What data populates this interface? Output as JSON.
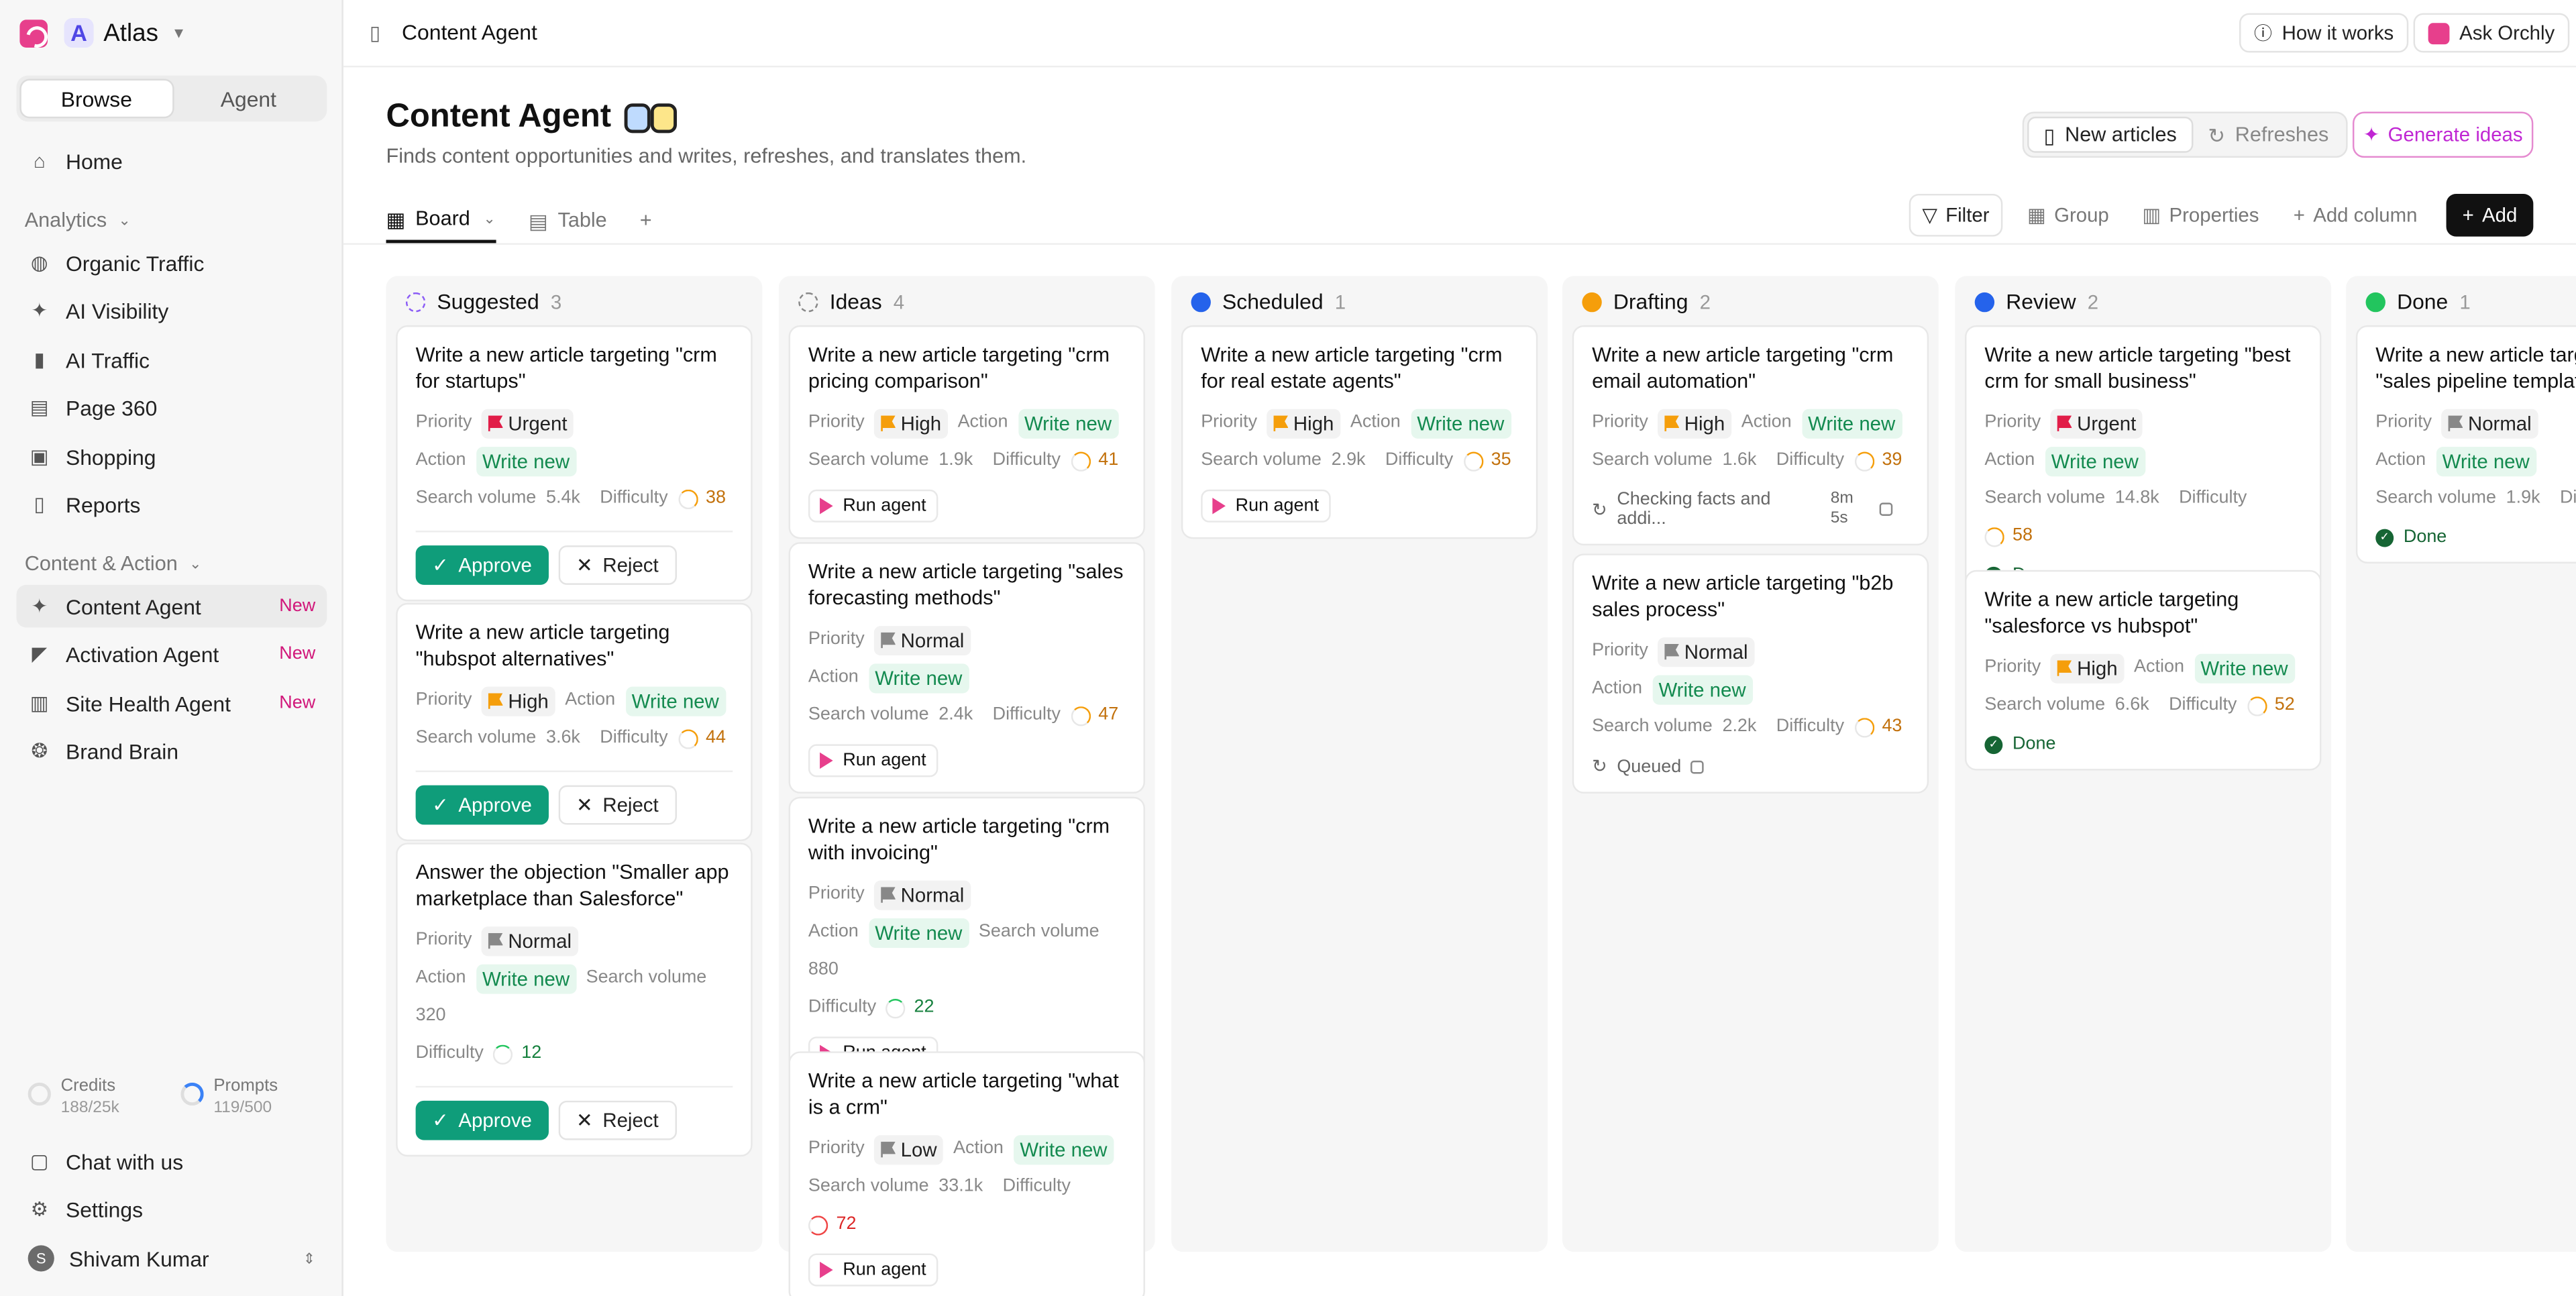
{
  "sidebar": {
    "workspace": "Atlas",
    "workspace_initial": "A",
    "modes": [
      "Browse",
      "Agent"
    ],
    "nav_top": [
      {
        "label": "Home",
        "icon": "home-icon"
      }
    ],
    "analytics_label": "Analytics",
    "analytics": [
      {
        "label": "Organic Traffic",
        "icon": "globe-icon"
      },
      {
        "label": "AI Visibility",
        "icon": "sparkle-icon"
      },
      {
        "label": "AI Traffic",
        "icon": "bar-chart-icon"
      },
      {
        "label": "Page 360",
        "icon": "layers-icon"
      },
      {
        "label": "Shopping",
        "icon": "bag-icon"
      },
      {
        "label": "Reports",
        "icon": "document-icon"
      }
    ],
    "content_label": "Content & Action",
    "content": [
      {
        "label": "Content Agent",
        "badge": "New",
        "icon": "sparkle-icon"
      },
      {
        "label": "Activation Agent",
        "badge": "New",
        "icon": "megaphone-icon"
      },
      {
        "label": "Site Health Agent",
        "badge": "New",
        "icon": "clipboard-icon"
      },
      {
        "label": "Brand Brain",
        "badge": "",
        "icon": "brain-icon"
      }
    ],
    "credits": {
      "label": "Credits",
      "value": "188/25k"
    },
    "prompts": {
      "label": "Prompts",
      "value": "119/500"
    },
    "chat": "Chat with us",
    "settings": "Settings",
    "user": {
      "name": "Shivam Kumar",
      "initial": "S"
    }
  },
  "topbar": {
    "breadcrumb": "Content Agent",
    "how": "How it works",
    "ask": "Ask Orchly"
  },
  "header": {
    "title": "Content Agent",
    "subtitle": "Finds content opportunities and writes, refreshes, and translates them.",
    "toggle": [
      "New articles",
      "Refreshes"
    ],
    "generate": "Generate ideas"
  },
  "views": {
    "board": "Board",
    "table": "Table",
    "filter": "Filter",
    "group": "Group",
    "properties": "Properties",
    "add_column": "Add column",
    "add": "Add"
  },
  "labels": {
    "priority": "Priority",
    "action": "Action",
    "search_volume": "Search volume",
    "difficulty": "Difficulty",
    "approve": "Approve",
    "reject": "Reject",
    "run_agent": "Run agent",
    "write_new": "Write new"
  },
  "columns": [
    {
      "name": "Suggested",
      "count": "3",
      "color": "#8b5cf6",
      "cards": [
        {
          "title": "Write a new article targeting \"crm for startups\"",
          "priority": "Urgent",
          "volume": "5.4k",
          "difficulty": "38"
        },
        {
          "title": "Write a new article targeting \"hubspot alternatives\"",
          "priority": "High",
          "volume": "3.6k",
          "difficulty": "44"
        },
        {
          "title": "Answer the objection \"Smaller app marketplace than Salesforce\"",
          "priority": "Normal",
          "volume": "320",
          "difficulty": "12"
        }
      ]
    },
    {
      "name": "Ideas",
      "count": "4",
      "color": "#888888",
      "cards": [
        {
          "title": "Write a new article targeting \"crm pricing comparison\"",
          "priority": "High",
          "volume": "1.9k",
          "difficulty": "41"
        },
        {
          "title": "Write a new article targeting \"sales forecasting methods\"",
          "priority": "Normal",
          "volume": "2.4k",
          "difficulty": "47"
        },
        {
          "title": "Write a new article targeting \"crm with invoicing\"",
          "priority": "Normal",
          "volume": "880",
          "difficulty": "22"
        },
        {
          "title": "Write a new article targeting \"what is a crm\"",
          "priority": "Low",
          "volume": "33.1k",
          "difficulty": "72"
        }
      ]
    },
    {
      "name": "Scheduled",
      "count": "1",
      "color": "#2563eb",
      "cards": [
        {
          "title": "Write a new article targeting \"crm for real estate agents\"",
          "priority": "High",
          "volume": "2.9k",
          "difficulty": "35"
        }
      ]
    },
    {
      "name": "Drafting",
      "count": "2",
      "color": "#f59e0b",
      "cards": [
        {
          "title": "Write a new article targeting \"crm email automation\"",
          "priority": "High",
          "volume": "1.6k",
          "difficulty": "39",
          "status": "Checking facts and addi...",
          "time": "8m 5s"
        },
        {
          "title": "Write a new article targeting \"b2b sales process\"",
          "priority": "Normal",
          "volume": "2.2k",
          "difficulty": "43",
          "status": "Queued"
        }
      ]
    },
    {
      "name": "Review",
      "count": "2",
      "color": "#2563eb",
      "cards": [
        {
          "title": "Write a new article targeting \"best crm for small business\"",
          "priority": "Urgent",
          "volume": "14.8k",
          "difficulty": "58",
          "status": "Done"
        },
        {
          "title": "Write a new article targeting \"salesforce vs hubspot\"",
          "priority": "High",
          "volume": "6.6k",
          "difficulty": "52",
          "status": "Done"
        }
      ]
    },
    {
      "name": "Done",
      "count": "1",
      "color": "#22c55e",
      "cards": [
        {
          "title": "Write a new article targ \"sales pipeline templat",
          "priority": "Normal",
          "volume": "1.9k",
          "difficulty_label": "Diffic",
          "status": "Done"
        }
      ]
    }
  ]
}
